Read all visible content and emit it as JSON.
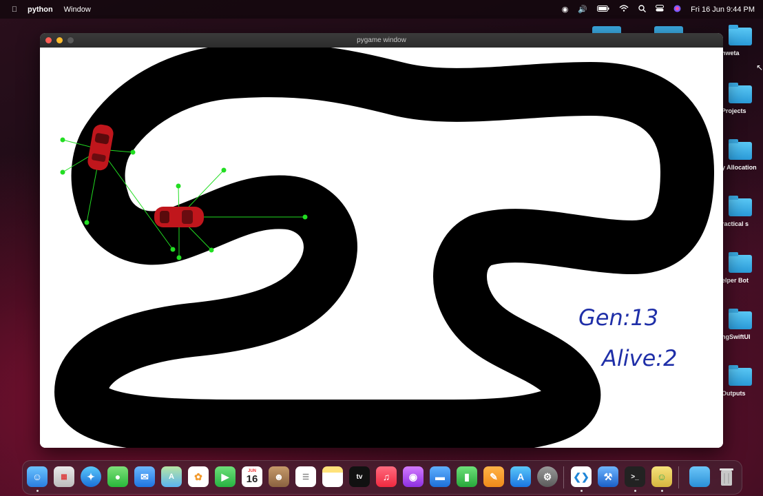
{
  "menubar": {
    "app": "python",
    "items": [
      "Window"
    ],
    "clock": "Fri 16 Jun  9:44 PM"
  },
  "window": {
    "title": "pygame window"
  },
  "hud": {
    "gen": "Gen:13",
    "alive": "Alive:2"
  },
  "desktop_icons": [
    "hweta",
    "Projects",
    "y Allocation",
    "ractical s",
    "elper Bot",
    "ngSwiftUI",
    "Outputs"
  ],
  "dock": {
    "calendar_day": "16",
    "calendar_month": "JUN",
    "tv_label": "tv",
    "apps": [
      "finder-icon",
      "launchpad-icon",
      "safari-icon",
      "messages-icon",
      "mail-icon",
      "maps-icon",
      "photos-icon",
      "facetime-icon",
      "calendar-icon",
      "contacts-icon",
      "reminders-icon",
      "notes-icon",
      "tv-icon",
      "music-icon",
      "podcasts-icon",
      "keynote-icon",
      "numbers-icon",
      "pages-icon",
      "app-store-icon",
      "system-settings-icon",
      "vscode-icon",
      "xcode-icon",
      "terminal-icon",
      "python-launcher-icon",
      "downloads-folder-icon",
      "trash-icon"
    ]
  },
  "colors": {
    "track": "#000000",
    "background": "#ffffff",
    "car": "#c0161c",
    "sensor": "#22dd22",
    "hud_text": "#1f2fa8"
  }
}
